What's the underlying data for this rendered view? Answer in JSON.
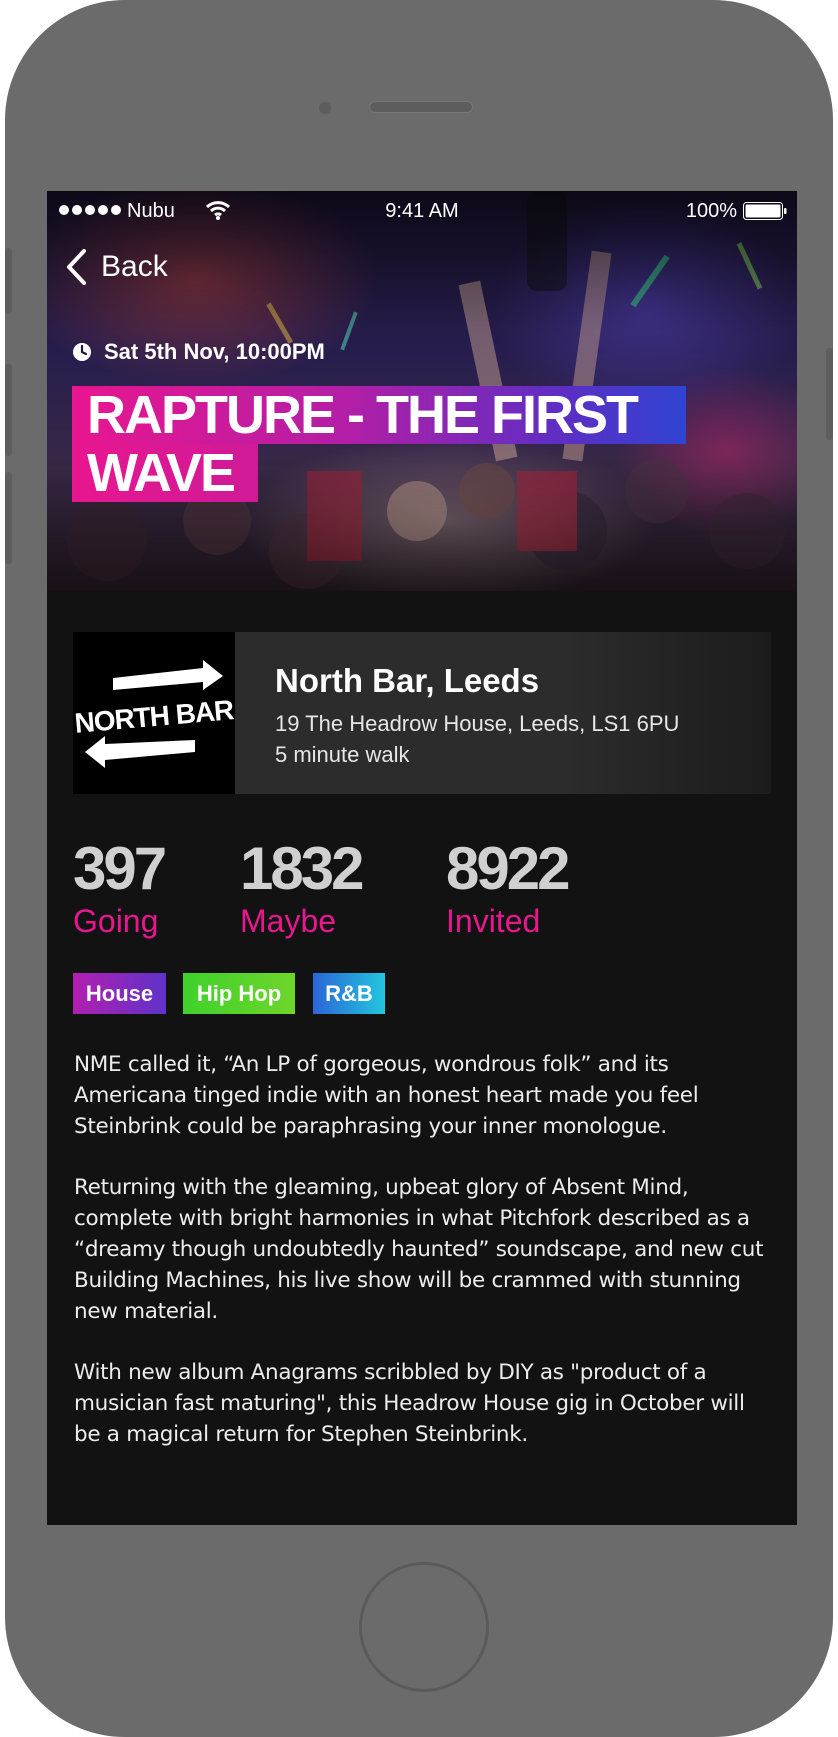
{
  "status_bar": {
    "carrier": "Nubu",
    "time": "9:41 AM",
    "battery": "100%"
  },
  "nav": {
    "back_label": "Back"
  },
  "event": {
    "datetime": "Sat 5th Nov, 10:00PM",
    "title_line_1": "RAPTURE - THE FIRST",
    "title_line_2": "WAVE"
  },
  "venue": {
    "logo_text": "NORTH BAR",
    "name": "North Bar, Leeds",
    "address": "19 The Headrow House, Leeds, LS1 6PU",
    "walk": "5 minute walk"
  },
  "stats": [
    {
      "value": "397",
      "label": "Going"
    },
    {
      "value": "1832",
      "label": "Maybe"
    },
    {
      "value": "8922",
      "label": "Invited"
    }
  ],
  "tags": [
    "House",
    "Hip Hop",
    "R&B"
  ],
  "description": [
    "NME called it, “An LP of gorgeous, wondrous folk” and its Americana tinged indie with an honest heart made you feel Steinbrink could be paraphrasing your inner monologue.",
    "Returning with the gleaming, upbeat glory of Absent Mind, complete with bright harmonies in what Pitchfork described as a “dreamy though undoubtedly haunted” soundscape, and new cut Building Machines, his live show will be crammed with stunning new material.",
    "With new album Anagrams scribbled by DIY as \"product of a musician fast maturing\", this Headrow House gig in October will be a magical return for Stephen Steinbrink."
  ],
  "colors": {
    "accent_pink": "#e8178f",
    "screen_bg": "#121212",
    "phone_body": "#6b6b6b"
  }
}
